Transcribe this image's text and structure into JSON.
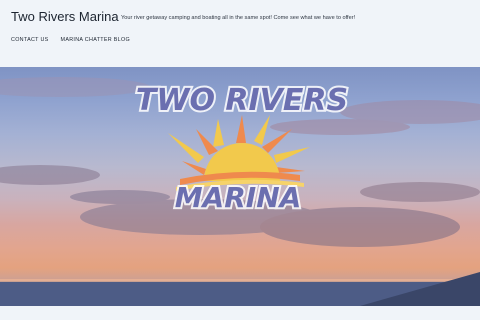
{
  "site": {
    "title": "Two Rivers Marina",
    "tagline": "Your river getaway camping and boating all in the same spot! Come see what we have to offer!"
  },
  "nav": {
    "items": [
      {
        "label": "CONTACT US"
      },
      {
        "label": "MARINA CHATTER BLOG"
      }
    ]
  },
  "hero": {
    "logo_line1": "TWO RIVERS",
    "logo_line2": "MARINA"
  },
  "colors": {
    "header_bg": "#f0f4f9",
    "logo_text": "#6b6fb0",
    "sun": "#f2c94c",
    "ray_orange": "#ef8a4d"
  }
}
